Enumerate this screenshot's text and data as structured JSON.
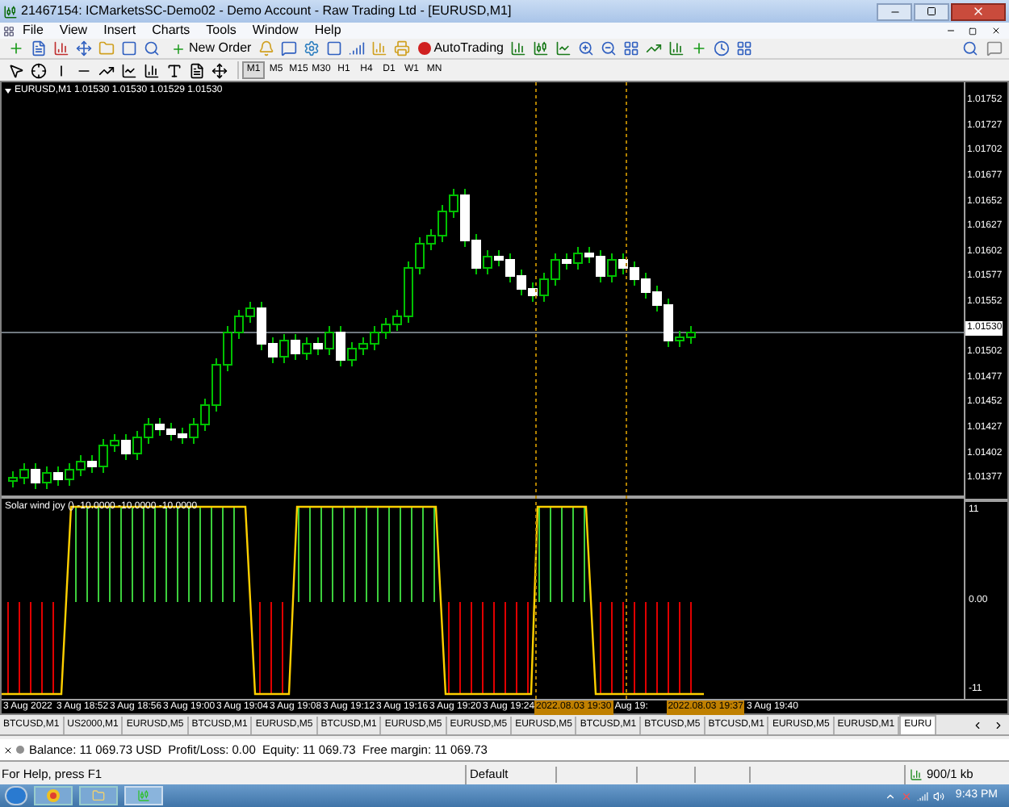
{
  "window": {
    "title": "21467154: ICMarketsSC-Demo02 - Demo Account - Raw Trading Ltd - [EURUSD,M1]"
  },
  "menu": [
    "File",
    "View",
    "Insert",
    "Charts",
    "Tools",
    "Window",
    "Help"
  ],
  "toolbar": {
    "new_order": "New Order",
    "auto_trading": "AutoTrading"
  },
  "timeframes": [
    {
      "label": "M1",
      "selected": true
    },
    {
      "label": "M5",
      "selected": false
    },
    {
      "label": "M15",
      "selected": false
    },
    {
      "label": "M30",
      "selected": false
    },
    {
      "label": "H1",
      "selected": false
    },
    {
      "label": "H4",
      "selected": false
    },
    {
      "label": "D1",
      "selected": false
    },
    {
      "label": "W1",
      "selected": false
    },
    {
      "label": "MN",
      "selected": false
    }
  ],
  "chart": {
    "header": "EURUSD,M1  1.01530 1.01530 1.01529 1.01530",
    "price_axis": [
      {
        "label": "1.01752",
        "highlighted": false
      },
      {
        "label": "1.01727",
        "highlighted": false
      },
      {
        "label": "1.01702",
        "highlighted": false
      },
      {
        "label": "1.01677",
        "highlighted": false
      },
      {
        "label": "1.01652",
        "highlighted": false
      },
      {
        "label": "1.01627",
        "highlighted": false
      },
      {
        "label": "1.01602",
        "highlighted": false
      },
      {
        "label": "1.01577",
        "highlighted": false
      },
      {
        "label": "1.01552",
        "highlighted": false
      },
      {
        "label": "1.01530",
        "highlighted": true
      },
      {
        "label": "1.01502",
        "highlighted": false
      },
      {
        "label": "1.01477",
        "highlighted": false
      },
      {
        "label": "1.01452",
        "highlighted": false
      },
      {
        "label": "1.01427",
        "highlighted": false
      },
      {
        "label": "1.01402",
        "highlighted": false
      },
      {
        "label": "1.01377",
        "highlighted": false
      }
    ],
    "indicator": {
      "label": "Solar wind joy () -10.0000 -10.0000 -10.0000",
      "axis": [
        "11",
        "0.00",
        "-11"
      ]
    },
    "time_axis": [
      {
        "label": "3 Aug 2022",
        "highlighted": false
      },
      {
        "label": "3 Aug 18:52",
        "highlighted": false
      },
      {
        "label": "3 Aug 18:56",
        "highlighted": false
      },
      {
        "label": "3 Aug 19:00",
        "highlighted": false
      },
      {
        "label": "3 Aug 19:04",
        "highlighted": false
      },
      {
        "label": "3 Aug 19:08",
        "highlighted": false
      },
      {
        "label": "3 Aug 19:12",
        "highlighted": false
      },
      {
        "label": "3 Aug 19:16",
        "highlighted": false
      },
      {
        "label": "3 Aug 19:20",
        "highlighted": false
      },
      {
        "label": "3 Aug 19:24",
        "highlighted": false
      },
      {
        "label": "2022.08.03 19:30",
        "highlighted": true
      },
      {
        "label": "Aug 19:",
        "highlighted": false
      },
      {
        "label": "2022.08.03 19:37",
        "highlighted": true
      },
      {
        "label": "3 Aug 19:40",
        "highlighted": false
      }
    ]
  },
  "tabs": [
    {
      "label": "BTCUSD,M1",
      "selected": false
    },
    {
      "label": "US2000,M1",
      "selected": false
    },
    {
      "label": "EURUSD,M5",
      "selected": false
    },
    {
      "label": "BTCUSD,M1",
      "selected": false
    },
    {
      "label": "EURUSD,M5",
      "selected": false
    },
    {
      "label": "BTCUSD,M1",
      "selected": false
    },
    {
      "label": "EURUSD,M5",
      "selected": false
    },
    {
      "label": "EURUSD,M5",
      "selected": false
    },
    {
      "label": "EURUSD,M5",
      "selected": false
    },
    {
      "label": "BTCUSD,M1",
      "selected": false
    },
    {
      "label": "BTCUSD,M5",
      "selected": false
    },
    {
      "label": "BTCUSD,M1",
      "selected": false
    },
    {
      "label": "EURUSD,M5",
      "selected": false
    },
    {
      "label": "EURUSD,M1",
      "selected": false
    },
    {
      "label": "EURU",
      "selected": true
    }
  ],
  "terminal": {
    "summary": "Balance: 11 069.73 USD  Profit/Loss: 0.00  Equity: 11 069.73  Free margin: 11 069.73"
  },
  "status_bar": {
    "help": "For Help, press F1",
    "profile": "Default",
    "traffic": "900/1 kb"
  },
  "taskbar": {
    "clock": "9:43 PM"
  }
}
